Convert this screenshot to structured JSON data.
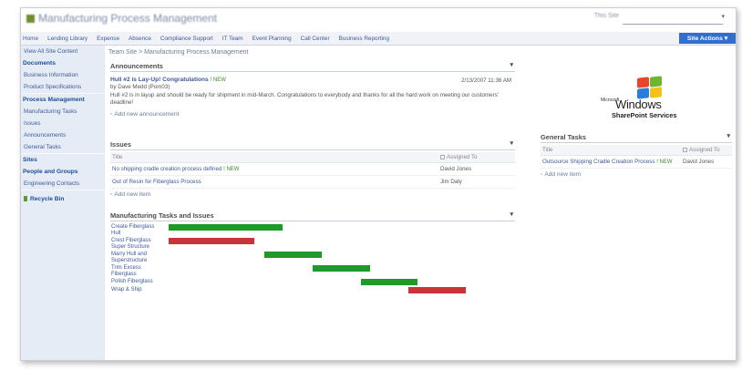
{
  "site": {
    "title": "Manufacturing Process Management",
    "search_label": "This Site",
    "search_dropdown": "▾"
  },
  "navtabs": [
    "Home",
    "Lending Library",
    "Expense",
    "Absence",
    "Compliance Support",
    "IT Team",
    "Event Planning",
    "Call Center",
    "Business Reporting"
  ],
  "site_actions": "Site Actions ▾",
  "breadcrumb": "Team Site > Manufacturing Process Management",
  "leftnav": {
    "view_all": "View All Site Content",
    "documents_hdr": "Documents",
    "documents": [
      "Business Information",
      "Product Specifications"
    ],
    "lists_hdr": "Process Management",
    "lists": [
      "Manufacturing Tasks",
      "Issues",
      "Announcements",
      "General Tasks"
    ],
    "sites_hdr": "Sites",
    "people_hdr": "People and Groups",
    "people": [
      "Engineering Contacts"
    ],
    "recycle": "Recycle Bin"
  },
  "announcements": {
    "title": "Announcements",
    "dropdown": "▾",
    "item_title": "Hull #2 is Lay-Up! Congratulations",
    "new_tag": "! NEW",
    "date": "2/13/2007 11:36 AM",
    "by": "by Dave Medd (Pom03)",
    "body": "Hull #2 is in layup and should be ready for shipment in mid-March.  Congratulations to everybody and thanks for all the hard work on meeting our customers' deadline!",
    "add_link": "Add new announcement"
  },
  "issues": {
    "title": "Issues",
    "dropdown": "▾",
    "columns": [
      "Title",
      "Assigned To"
    ],
    "rows": [
      {
        "title": "No shipping cradle creation process defined",
        "new": "! NEW",
        "assigned": "David Jones"
      },
      {
        "title": "Out of Resin for Fiberglass Process",
        "new": "",
        "assigned": "Jim Daly"
      }
    ],
    "add_link": "Add new item"
  },
  "mfg": {
    "title": "Manufacturing Tasks and Issues",
    "dropdown": "▾",
    "rows": [
      {
        "label": "Create Fiberglass Hull",
        "start": 0.0,
        "end": 0.28,
        "color": "#1e9a2a"
      },
      {
        "label": "Crest Fiberglass Super Structure",
        "start": 0.0,
        "end": 0.21,
        "color": "#c8343a"
      },
      {
        "label": "Marry Hull and Superstructure",
        "start": 0.28,
        "end": 0.42,
        "color": "#1e9a2a"
      },
      {
        "label": "Trim Excess Fiberglass",
        "start": 0.42,
        "end": 0.56,
        "color": "#1e9a2a"
      },
      {
        "label": "Polish Fiberglass",
        "start": 0.56,
        "end": 0.7,
        "color": "#1e9a2a"
      },
      {
        "label": "Wrap & Ship",
        "start": 0.7,
        "end": 0.84,
        "color": "#c8343a"
      }
    ]
  },
  "general_tasks": {
    "title": "General Tasks",
    "dropdown": "▾",
    "columns": [
      "Title",
      "Assigned To"
    ],
    "rows": [
      {
        "title": "Outsource Shipping Cradle Creation Process",
        "new": "! NEW",
        "assigned": "David Jones"
      }
    ],
    "add_link": "Add new item"
  },
  "logo": {
    "microsoft": "Microsoft",
    "windows": "Windows",
    "sps": "SharePoint Services"
  }
}
